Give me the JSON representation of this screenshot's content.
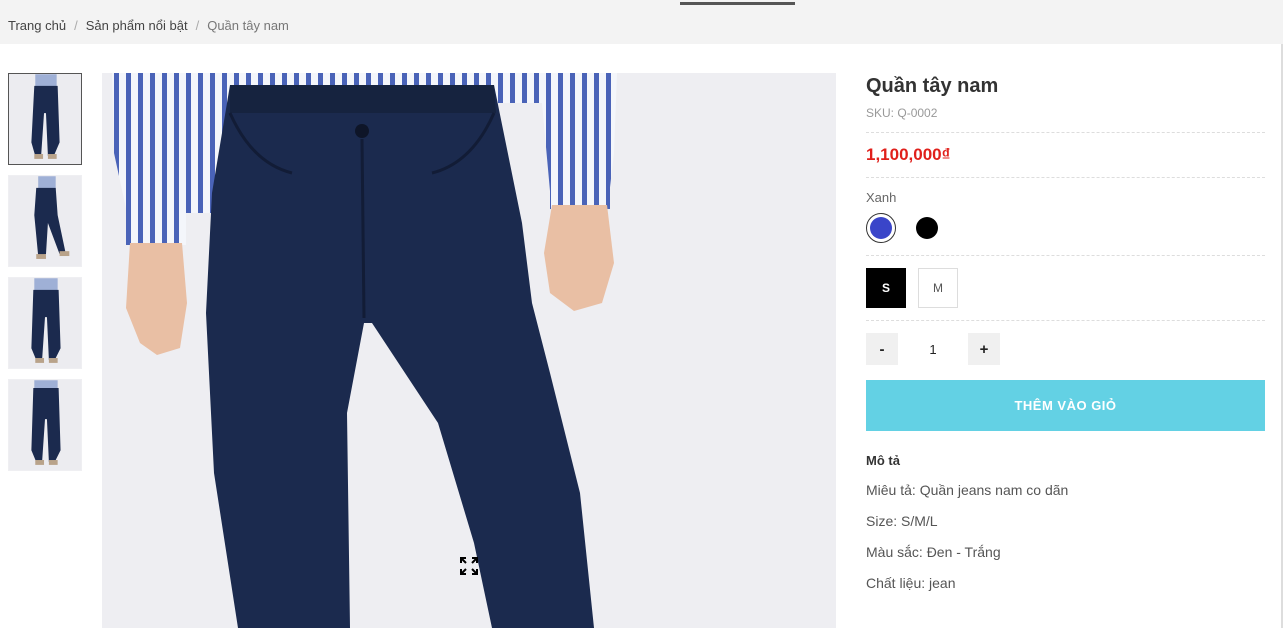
{
  "breadcrumb": {
    "home": "Trang chủ",
    "category": "Sản phẩm nổi bật",
    "current": "Quần tây nam",
    "separator": "/"
  },
  "product": {
    "title": "Quần tây nam",
    "sku_label": "SKU:",
    "sku_value": "Q-0002",
    "price": "1,100,000₫",
    "color_label": "Xanh",
    "colors": [
      {
        "name": "Xanh",
        "hex": "#3a45c9",
        "selected": true
      },
      {
        "name": "Đen",
        "hex": "#000000",
        "selected": false
      }
    ],
    "sizes": [
      {
        "label": "S",
        "selected": true
      },
      {
        "label": "M",
        "selected": false
      }
    ],
    "quantity": {
      "minus": "-",
      "value": "1",
      "plus": "+"
    },
    "add_to_cart": "THÊM VÀO GIỎ",
    "description": {
      "title": "Mô tả",
      "lines": [
        "Miêu tả: Quần jeans nam co dãn",
        "Size: S/M/L",
        "Màu sắc: Đen - Trắng",
        "Chất liệu: jean"
      ]
    }
  },
  "gallery": {
    "thumbnail_count": 4,
    "active_index": 0,
    "zoom_icon": "expand-icon"
  },
  "colors": {
    "price_red": "#e0201b",
    "cart_button": "#63d1e4",
    "pants_navy": "#1b2a4e"
  }
}
